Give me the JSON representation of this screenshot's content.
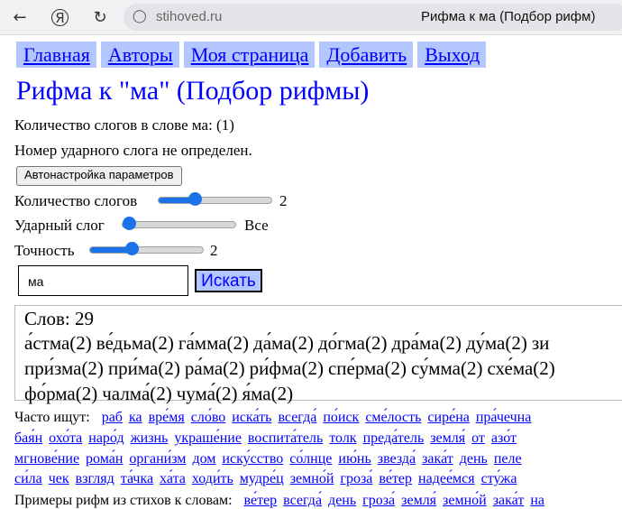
{
  "browser": {
    "url": "stihoved.ru",
    "tab_title": "Рифма к ма (Подбор рифм)"
  },
  "nav": [
    {
      "label": "Главная"
    },
    {
      "label": "Авторы"
    },
    {
      "label": "Моя страница"
    },
    {
      "label": "Добавить"
    },
    {
      "label": "Выход"
    }
  ],
  "title": "Рифма к \"ма\" (Подбор рифмы)",
  "info": {
    "syllables": "Количество слогов в слове ма: (1)",
    "stress": "Номер ударного слога не определен."
  },
  "auto_button": "Автонастройка параметров",
  "params": {
    "syllables_label": "Количество слогов",
    "syllables_value": "2",
    "syllables_level": 0.3,
    "stress_label": "Ударный слог",
    "stress_value": "Все",
    "stress_level": 0.0,
    "precision_label": "Точность",
    "precision_value": "2",
    "precision_level": 0.35
  },
  "search": {
    "value": "ма",
    "button": "Искать"
  },
  "results": {
    "count": "Слов: 29",
    "lines": [
      [
        "а́стма(2)",
        "ве́дьма(2)",
        "га́мма(2)",
        "да́ма(2)",
        "до́гма(2)",
        "дра́ма(2)",
        "ду́ма(2)",
        "зи"
      ],
      [
        "при́зма(2)",
        "при́ма(2)",
        "ра́ма(2)",
        "ри́фма(2)",
        "спе́рма(2)",
        "су́мма(2)",
        "схе́ма(2)"
      ],
      [
        "фо́рма(2)",
        "чалма́(2)",
        "чума́(2)",
        "я́ма(2)"
      ]
    ]
  },
  "popular": {
    "label": "Часто ищут:",
    "rows": [
      [
        "раб",
        "ка",
        "вре́мя",
        "сло́во",
        "иска́ть",
        "всегда́",
        "по́иск",
        "сме́лость",
        "сире́на",
        "пра́чечна"
      ],
      [
        "бая́н",
        "охо́та",
        "наро́д",
        "жизнь",
        "украше́ние",
        "воспита́тель",
        "толк",
        "преда́тель",
        "земля́",
        "от",
        "азо́т"
      ],
      [
        "мгнове́ние",
        "рома́н",
        "органи́зм",
        "дом",
        "иску́сство",
        "со́лнце",
        "ию́нь",
        "звезда́",
        "зака́т",
        "день",
        "пеле"
      ],
      [
        "си́ла",
        "чек",
        "взгляд",
        "та́чка",
        "ха́та",
        "ходи́ть",
        "мудре́ц",
        "земно́й",
        "гроза́",
        "ве́тер",
        "надее́мся",
        "сту́жа"
      ]
    ]
  },
  "examples": {
    "label": "Примеры рифм из стихов к словам:",
    "items": [
      "ве́тер",
      "всегда́",
      "день",
      "гроза́",
      "земля́",
      "земно́й",
      "зака́т",
      "на"
    ]
  }
}
